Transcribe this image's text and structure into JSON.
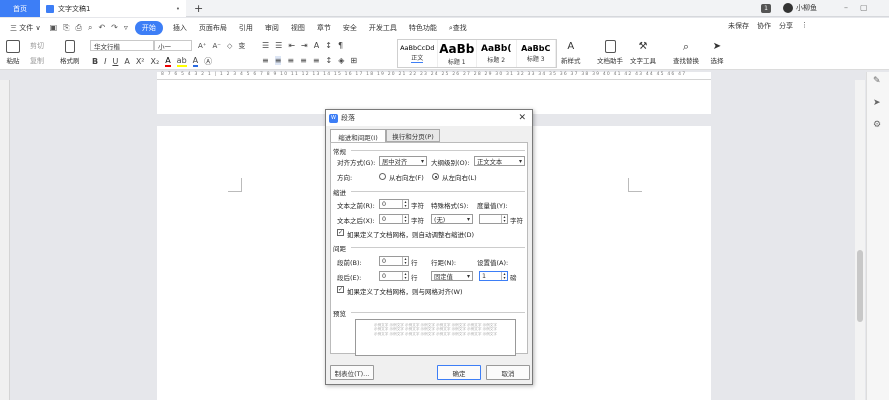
{
  "tabs": {
    "home": "首页",
    "doc": "文字文稿1",
    "new": "+"
  },
  "titlebar_right": {
    "badge": "1",
    "user": "小柳鱼"
  },
  "menu": {
    "file": "三 文件 ∨",
    "start": "开始",
    "items": [
      "插入",
      "页面布局",
      "引用",
      "审阅",
      "视图",
      "章节",
      "安全",
      "开发工具",
      "特色功能"
    ],
    "search": "查找",
    "right": [
      "未保存",
      "协作",
      "分享",
      "⋮"
    ]
  },
  "ribbon": {
    "paste": "粘贴",
    "cut": "剪切",
    "copy": "复制",
    "format_painter": "格式刷",
    "font_name": "华文行楷",
    "font_size": "小一",
    "styles": [
      {
        "preview": "AaBbCcDd",
        "name": "正文"
      },
      {
        "preview": "AaBb",
        "name": "标题 1"
      },
      {
        "preview": "AaBb(",
        "name": "标题 2"
      },
      {
        "preview": "AaBbC",
        "name": "标题 3"
      }
    ],
    "new_style": "新样式",
    "doc_assistant": "文档助手",
    "text_tools": "文字工具",
    "find_replace": "查找替换",
    "select": "选择"
  },
  "ruler": {
    "ticks": "8 7 6 5 4 3 2 1 | 1 2 3 4 5 6 7 8 9 10 11 12 13 14 15 16 17 18 19 20 21 22 23 24 25 26 27 28 29 30 31 32 33 34 35 36 37 38 39 40 41 42 43 44 45 46 47"
  },
  "dialog": {
    "title": "段落",
    "tab_indent": "缩进和间距(I)",
    "tab_breaks": "换行和分页(P)",
    "sec_general": "常规",
    "align_label": "对齐方式(G):",
    "align_value": "居中对齐",
    "outline_label": "大纲级别(O):",
    "outline_value": "正文文本",
    "direction_label": "方向:",
    "dir_rtl": "从右向左(F)",
    "dir_ltr": "从左向右(L)",
    "sec_indent": "缩进",
    "before_text_label": "文本之前(R):",
    "before_text_value": "0",
    "before_text_unit": "字符",
    "special_label": "特殊格式(S):",
    "special_value": "(无)",
    "measure_label": "度量值(Y):",
    "measure_value": "",
    "measure_unit": "字符",
    "after_text_label": "文本之后(X):",
    "after_text_value": "0",
    "after_text_unit": "字符",
    "auto_indent": "如果定义了文档网格，则自动调整右缩进(D)",
    "sec_spacing": "间距",
    "before_label": "段前(B):",
    "before_value": "0",
    "before_unit": "行",
    "after_label": "段后(E):",
    "after_value": "0",
    "after_unit": "行",
    "line_spacing_label": "行距(N):",
    "line_spacing_value": "固定值",
    "set_value_label": "设置值(A):",
    "set_value_value": "1",
    "set_value_unit": "磅",
    "snap_grid": "如果定义了文档网格，则与网格对齐(W)",
    "sec_preview": "预览",
    "preview_text": "示例文字 示例文字 示例文字 示例文字 示例文字 示例文字 示例文字 示例文字 示例文字 示例文字 示例文字 示例文字 示例文字 示例文字 示例文字 示例文字 示例文字 示例文字 示例文字 示例文字 示例文字 示例文字 示例文字 示例文字",
    "tabs_button": "制表位(T)...",
    "ok": "确定",
    "cancel": "取消"
  }
}
